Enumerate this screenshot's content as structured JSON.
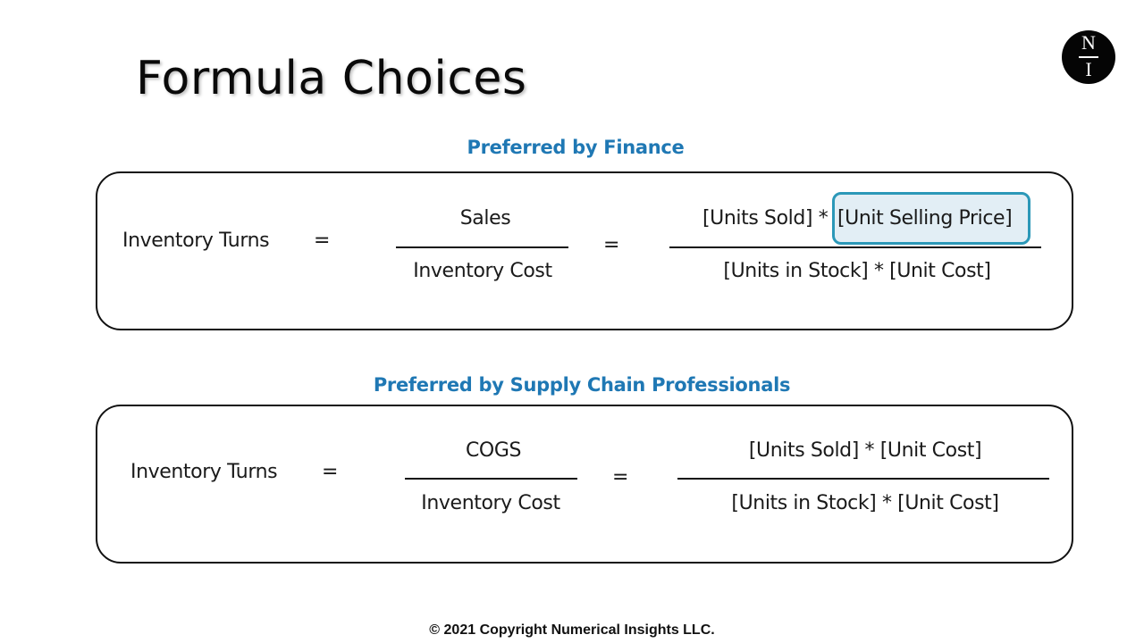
{
  "slide": {
    "title": "Formula Choices",
    "logo": {
      "top_letter": "N",
      "bottom_letter": "I",
      "icon": "ni-monogram-logo"
    },
    "footer": "© 2021 Copyright Numerical Insights LLC."
  },
  "finance": {
    "label": "Preferred by Finance",
    "lhs": "Inventory Turns",
    "equals": "=",
    "fraction1": {
      "numerator": "Sales",
      "denominator": "Inventory Cost"
    },
    "equals2": "=",
    "fraction2": {
      "numerator_part1": "[Units Sold] *",
      "numerator_highlight": "[Unit Selling Price]",
      "denominator": "[Units in Stock] * [Unit Cost]"
    },
    "highlight_color": "#2b98b8"
  },
  "supply_chain": {
    "label": "Preferred by Supply Chain Professionals",
    "lhs": "Inventory Turns",
    "equals": "=",
    "fraction1": {
      "numerator": "COGS",
      "denominator": "Inventory Cost"
    },
    "equals2": "=",
    "fraction2": {
      "numerator": "[Units Sold] * [Unit Cost]",
      "denominator": "[Units in Stock] * [Unit Cost]"
    }
  },
  "colors": {
    "accent": "#1f78b4"
  }
}
